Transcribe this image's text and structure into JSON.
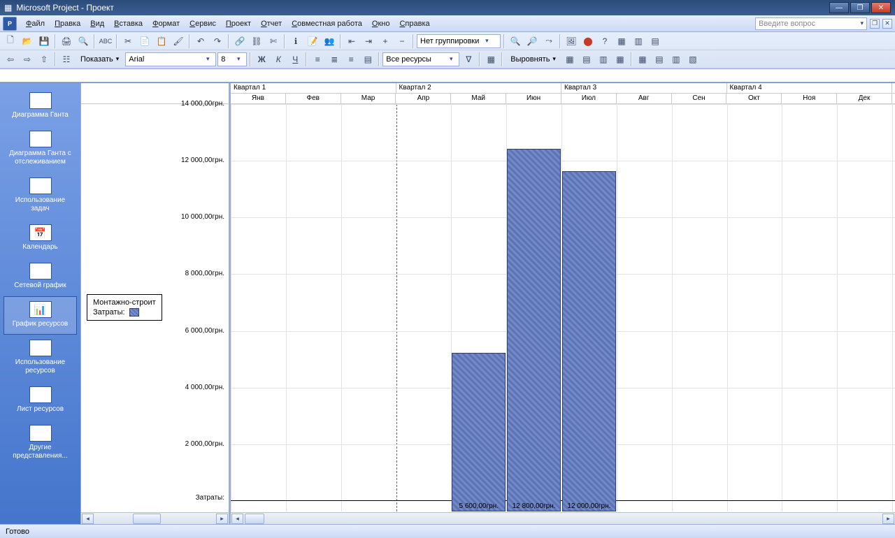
{
  "title": "Microsoft Project - Проект",
  "menu": [
    "Файл",
    "Правка",
    "Вид",
    "Вставка",
    "Формат",
    "Сервис",
    "Проект",
    "Отчет",
    "Совместная работа",
    "Окно",
    "Справка"
  ],
  "help_placeholder": "Введите вопрос",
  "toolbar": {
    "group_by": "Нет группировки",
    "show_label": "Показать",
    "font": "Arial",
    "font_size": "8",
    "resources_filter": "Все ресурсы",
    "align_label": "Выровнять"
  },
  "sidebar": {
    "items": [
      {
        "label": "Диаграмма Ганта"
      },
      {
        "label": "Диаграмма Ганта с отслеживанием"
      },
      {
        "label": "Использование задач"
      },
      {
        "label": "Календарь"
      },
      {
        "label": "Сетевой график"
      },
      {
        "label": "График ресурсов"
      },
      {
        "label": "Использование ресурсов"
      },
      {
        "label": "Лист ресурсов"
      },
      {
        "label": "Другие представления..."
      }
    ],
    "active_index": 5
  },
  "legend": {
    "title": "Монтажно-строит",
    "series": "Затраты:"
  },
  "chart_data": {
    "type": "bar",
    "currency_suffix": "грн.",
    "yaxis": {
      "ticks": [
        "14 000,00грн.",
        "12 000,00грн.",
        "10 000,00грн.",
        "8 000,00грн.",
        "6 000,00грн.",
        "4 000,00грн.",
        "2 000,00грн.",
        "Затраты:"
      ],
      "max": 14000
    },
    "quarters": [
      "Квартал 1",
      "Квартал 2",
      "Квартал 3",
      "Квартал 4"
    ],
    "months": [
      "Янв",
      "Фев",
      "Мар",
      "Апр",
      "Май",
      "Июн",
      "Июл",
      "Авг",
      "Сен",
      "Окт",
      "Ноя",
      "Дек"
    ],
    "today_month_index": 3,
    "bars": [
      {
        "month_index": 4,
        "value": 5600,
        "label": "5 600,00грн."
      },
      {
        "month_index": 5,
        "value": 12800,
        "label": "12 800,00грн."
      },
      {
        "month_index": 6,
        "value": 12000,
        "label": "12 000,00грн."
      }
    ]
  },
  "status": "Готово"
}
